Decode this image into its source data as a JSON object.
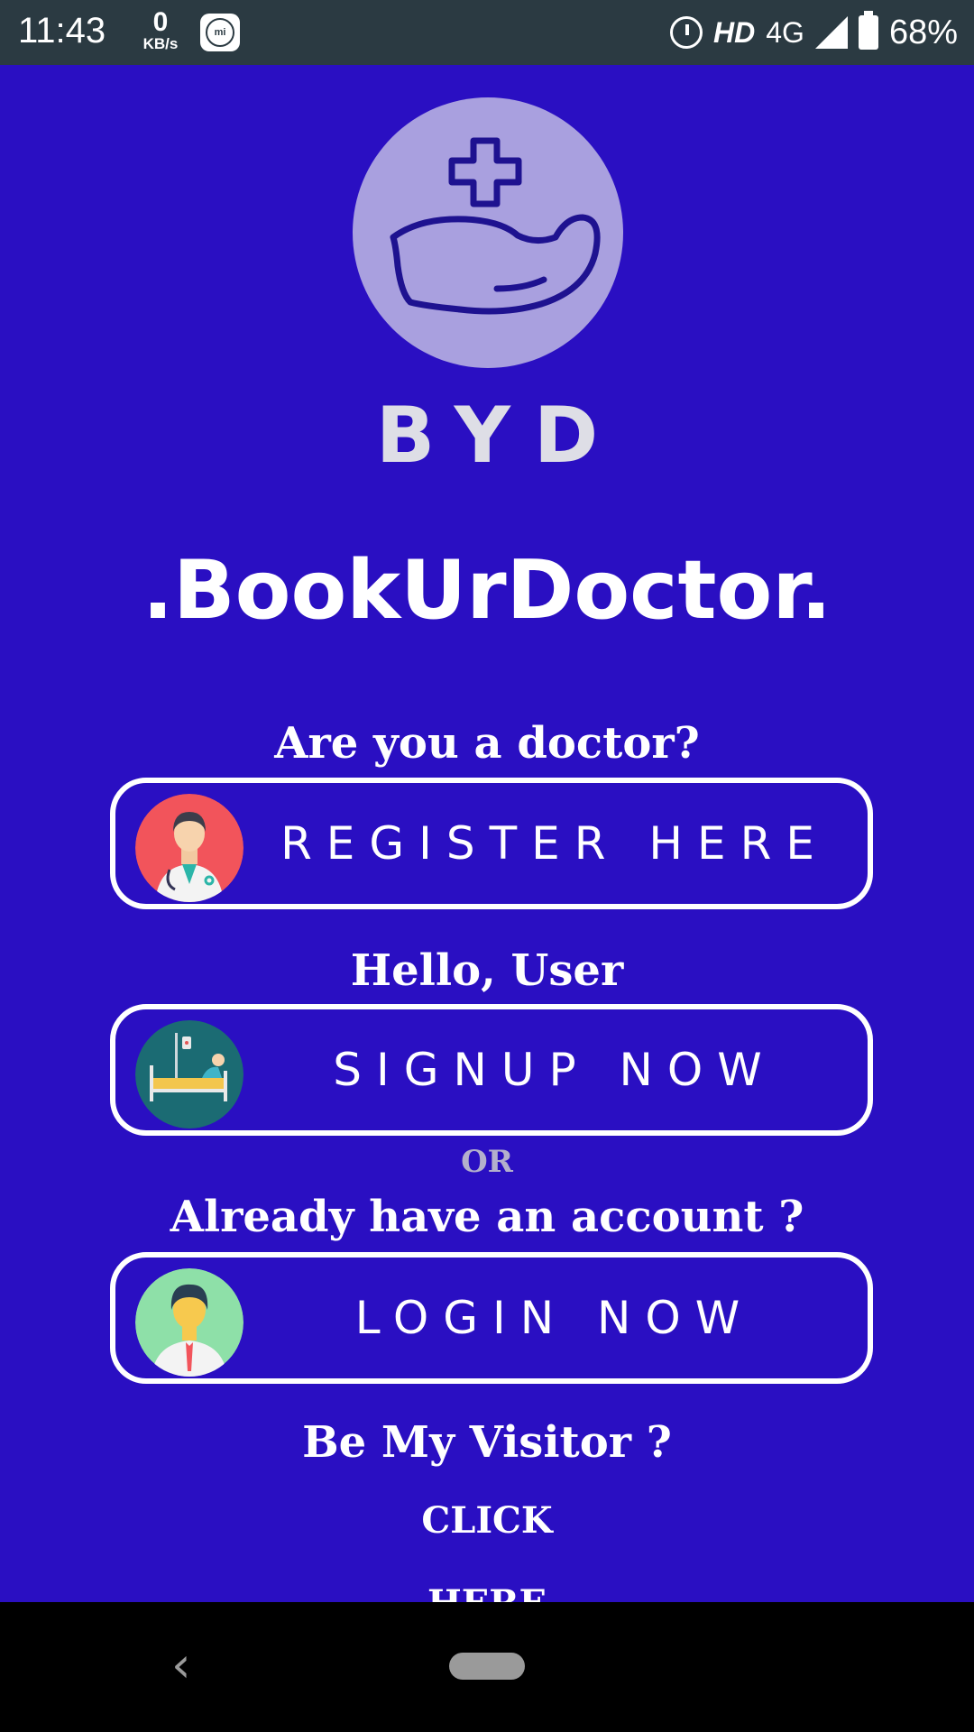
{
  "status_bar": {
    "time": "11:43",
    "net_speed_value": "0",
    "net_speed_unit": "KB/s",
    "network_badge": "HD",
    "network_type": "4G",
    "battery": "68%"
  },
  "logo": {
    "initials": "BYD"
  },
  "app_name": ".BookUrDoctor.",
  "doctor_section": {
    "prompt": "Are you a doctor?",
    "button_label": "REGISTER HERE"
  },
  "user_section": {
    "prompt": "Hello, User",
    "button_label": "SIGNUP NOW"
  },
  "separator": "OR",
  "login_section": {
    "prompt": "Already have an account ?",
    "button_label": "LOGIN NOW"
  },
  "visitor_section": {
    "prompt": "Be My Visitor ?",
    "link_label": "CLICK HERE"
  },
  "colors": {
    "background": "#2a0fc2",
    "logo_circle": "#a9a0df",
    "status_bar": "#2b3a42"
  }
}
